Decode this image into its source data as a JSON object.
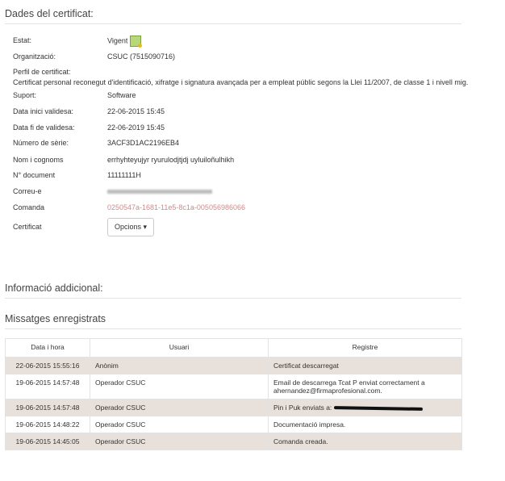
{
  "sections": {
    "details": "Dades del certificat:",
    "additional": "Informació addicional:",
    "messages": "Missatges enregistrats"
  },
  "fields": {
    "status": {
      "label": "Estat:",
      "value": "Vigent",
      "icon": "certificate-icon"
    },
    "organization": {
      "label": "Organització:",
      "value": "CSUC (7515090716)"
    },
    "profile": {
      "label": "Perfil de certificat:",
      "value": "Certificat personal reconegut d'identificació, xifratge i signatura avançada per a empleat públic segons la Llei 11/2007, de classe 1 i nivell mig."
    },
    "support": {
      "label": "Suport:",
      "value": "Software"
    },
    "valid_from": {
      "label": "Data inici validesa:",
      "value": "22-06-2015 15:45"
    },
    "valid_to": {
      "label": "Data fi de validesa:",
      "value": "22-06-2019 15:45"
    },
    "serial": {
      "label": "Número de sèrie:",
      "value": "3ACF3D1AC2196EB4"
    },
    "name": {
      "label": "Nom i cognoms",
      "value": "errhyhteyujyr ryurulodjtjdj uyluiloñulhikh"
    },
    "document": {
      "label": "N° document",
      "value": "11111111H"
    },
    "email": {
      "label": "Correu-e"
    },
    "order": {
      "label": "Comanda",
      "value": "0250547a-1681-11e5-8c1a-005056986066"
    },
    "certificate": {
      "label": "Certificat",
      "button": "Opcions ▾"
    }
  },
  "table": {
    "headers": [
      "Data i hora",
      "Usuari",
      "Registre"
    ],
    "rows": [
      {
        "date": "22-06-2015 15:55:16",
        "user": "Anònim",
        "log": "Certificat descarregat"
      },
      {
        "date": "19-06-2015 14:57:48",
        "user": "Operador CSUC",
        "log": "Email de descarrega Tcat P enviat correctament a ahernandez@firmaprofesional.com."
      },
      {
        "date": "19-06-2015 14:57:48",
        "user": "Operador CSUC",
        "log": "Pin i Puk enviats a:"
      },
      {
        "date": "19-06-2015 14:48:22",
        "user": "Operador CSUC",
        "log": "Documentació impresa."
      },
      {
        "date": "19-06-2015 14:45:05",
        "user": "Operador CSUC",
        "log": "Comanda creada."
      }
    ]
  },
  "colors": {
    "row_alt": "#e8e0da",
    "link": "#d08a8a"
  }
}
